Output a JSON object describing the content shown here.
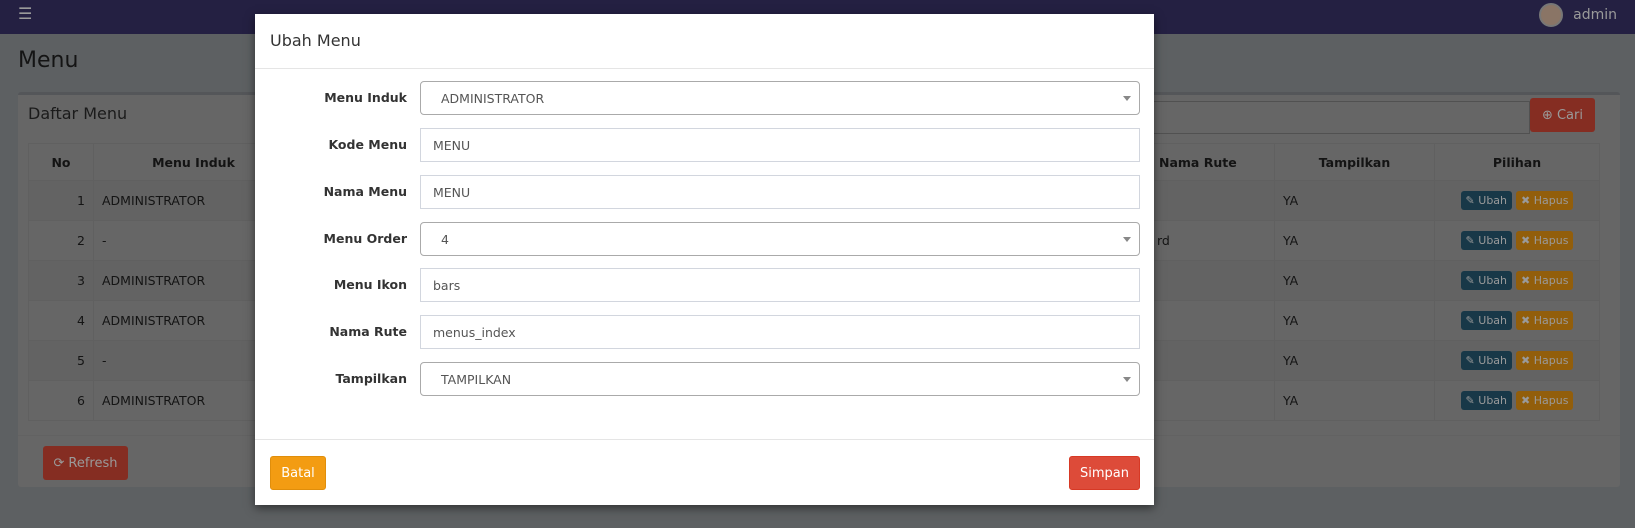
{
  "navbar": {
    "menu_icon": "bars-icon",
    "user": "admin"
  },
  "page": {
    "title": "Menu"
  },
  "box": {
    "title": "Daftar Menu",
    "search_button": "Cari",
    "refresh_button": "Refresh"
  },
  "table": {
    "headers": [
      "No",
      "Menu Induk",
      "Nama Rute",
      "Tampilkan",
      "Pilihan"
    ],
    "rows": [
      {
        "no": "1",
        "induk": "ADMINISTRATOR",
        "rute": "",
        "tampil": "YA"
      },
      {
        "no": "2",
        "induk": "-",
        "rute": "rd",
        "tampil": "YA"
      },
      {
        "no": "3",
        "induk": "ADMINISTRATOR",
        "rute": "",
        "tampil": "YA"
      },
      {
        "no": "4",
        "induk": "ADMINISTRATOR",
        "rute": "",
        "tampil": "YA"
      },
      {
        "no": "5",
        "induk": "-",
        "rute": "",
        "tampil": "YA"
      },
      {
        "no": "6",
        "induk": "ADMINISTRATOR",
        "rute": "",
        "tampil": "YA"
      }
    ],
    "edit_label": "Ubah",
    "delete_label": "Hapus"
  },
  "modal": {
    "title": "Ubah Menu",
    "fields": [
      {
        "label": "Menu Induk",
        "value": "ADMINISTRATOR",
        "type": "select"
      },
      {
        "label": "Kode Menu",
        "value": "MENU",
        "type": "text"
      },
      {
        "label": "Nama Menu",
        "value": "MENU",
        "type": "text"
      },
      {
        "label": "Menu Order",
        "value": "4",
        "type": "select"
      },
      {
        "label": "Menu Ikon",
        "value": "bars",
        "type": "text"
      },
      {
        "label": "Nama Rute",
        "value": "menus_index",
        "type": "text"
      },
      {
        "label": "Tampilkan",
        "value": "TAMPILKAN",
        "type": "select"
      }
    ],
    "cancel": "Batal",
    "save": "Simpan"
  }
}
